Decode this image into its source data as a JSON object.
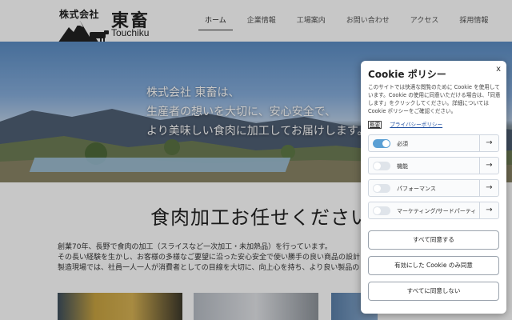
{
  "header": {
    "company_prefix": "株式会社",
    "company_name": "東畜",
    "company_roman": "Touchiku",
    "nav": [
      {
        "label": "ホーム",
        "active": true
      },
      {
        "label": "企業情報",
        "active": false
      },
      {
        "label": "工場案内",
        "active": false
      },
      {
        "label": "お問い合わせ",
        "active": false
      },
      {
        "label": "アクセス",
        "active": false
      },
      {
        "label": "採用情報",
        "active": false
      }
    ]
  },
  "hero": {
    "lines": [
      "株式会社 東畜は、",
      "生産者の想いを大切に、安心安全で、",
      "より美味しい食肉に加工してお届けします。"
    ]
  },
  "main": {
    "title": "食肉加工お任せください",
    "paragraph": [
      "創業70年、長野で食肉の加工（スライスなど一次加工・未加熱品）を行っています。",
      "その長い経験を生かし、お客様の多様なご要望に沿った安心安全で使い勝手の良い商品の設計",
      "製造現場では、社員一人一人が消費者としての目線を大切に、向上心を持ち、より良い製品の"
    ]
  },
  "cookie": {
    "title": "Cookie ポリシー",
    "close_label": "x",
    "description": "このサイトでは快適な閲覧のために Cookie を使用しています。Cookie の使用に同意いただける場合は、「同意します」をクリックしてください。詳細については Cookie ポリシーをご確認ください。",
    "link_overview": "概要",
    "link_privacy": "プライバシーポリシー",
    "categories": [
      {
        "label": "必須",
        "enabled": true
      },
      {
        "label": "機能",
        "enabled": false
      },
      {
        "label": "パフォーマンス",
        "enabled": false
      },
      {
        "label": "マーケティング/サードパーティ",
        "enabled": false
      }
    ],
    "arrow": "→",
    "buttons": {
      "accept_all": "すべて同意する",
      "accept_enabled": "有効にした Cookie のみ同意",
      "reject_all": "すべてに同意しない"
    }
  },
  "colors": {
    "accent": "#5a9fd4",
    "link": "#1f4fa0"
  }
}
